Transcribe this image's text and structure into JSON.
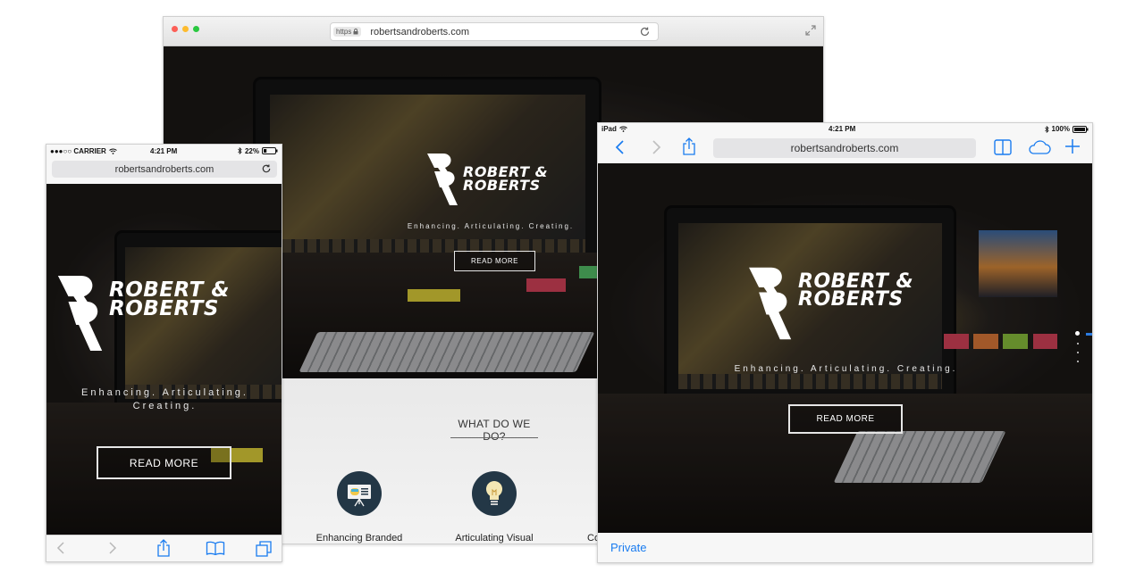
{
  "brand": {
    "name_line1": "ROBERT &",
    "name_line2": "ROBERTS",
    "tagline": "Enhancing. Articulating. Creating.",
    "tagline_mobile_1": "Enhancing. Articulating.",
    "tagline_mobile_2": "Creating.",
    "cta": "READ MORE"
  },
  "desktop": {
    "url": "robertsandroberts.com",
    "https_label": "https",
    "section_title": "WHAT DO WE DO?",
    "services": [
      {
        "label": "Enhancing Branded"
      },
      {
        "label": "Articulating Visual"
      },
      {
        "label": "Co"
      }
    ]
  },
  "phone": {
    "carrier": "●●●○○ CARRIER",
    "time": "4:21 PM",
    "battery": "22%",
    "url": "robertsandroberts.com"
  },
  "tablet": {
    "device": "iPad",
    "time": "4:21 PM",
    "battery": "100%",
    "url": "robertsandroberts.com",
    "private_label": "Private"
  },
  "colors": {
    "accent_blue": "#1a7cf0",
    "service_circle": "#233746",
    "light_red": "#fc5f57",
    "light_yellow": "#fdbb2e",
    "light_green": "#2ac840"
  }
}
